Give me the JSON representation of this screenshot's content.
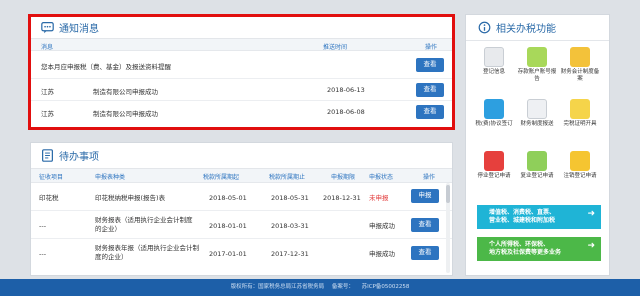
{
  "notice": {
    "title": "通知消息",
    "columns": [
      "消息",
      "推送时间",
      "操作"
    ],
    "rows": [
      {
        "source": "您本月应申报税（费、基金）及报送资料提醒",
        "desc": "",
        "date": "",
        "action": "查看"
      },
      {
        "source": "江苏",
        "desc": "制造有限公司申报成功",
        "date": "2018-06-13",
        "action": "查看"
      },
      {
        "source": "江苏",
        "desc": "制造有限公司申报成功",
        "date": "2018-06-08",
        "action": "查看"
      }
    ]
  },
  "todo": {
    "title": "待办事项",
    "columns": [
      "征收项目",
      "申报表种类",
      "税款所属期起",
      "税款所属期止",
      "申报期限",
      "申报状态",
      "操作"
    ],
    "rows": [
      {
        "item": "印花税",
        "form": "印花税纳税申报(报告)表",
        "start": "2018-05-01",
        "end": "2018-05-31",
        "deadline": "2018-12-31",
        "status": "未申报",
        "action": "申报"
      },
      {
        "item": "---",
        "form": "财务报表（适用执行企业会计制度的企业）",
        "start": "2018-01-01",
        "end": "2018-03-31",
        "deadline": "",
        "status": "申报成功",
        "action": "查看"
      },
      {
        "item": "---",
        "form": "财务报表年报（适用执行企业会计制度的企业）",
        "start": "2017-01-01",
        "end": "2017-12-31",
        "deadline": "",
        "status": "申报成功",
        "action": "查看"
      }
    ]
  },
  "related": {
    "title": "相关办税功能",
    "tiles": [
      {
        "label": "登记信息",
        "color": "#e8eaed",
        "icon": "id-card-icon"
      },
      {
        "label": "存款账户账号报告",
        "color": "#a8d85a",
        "icon": "bank-card-icon"
      },
      {
        "label": "财务会计制度备案",
        "color": "#f3c23a",
        "icon": "accounting-icon"
      },
      {
        "label": "税(费)协议签订",
        "color": "#2d9fe0",
        "icon": "agreement-icon"
      },
      {
        "label": "财务制度报送",
        "color": "#eef0f3",
        "icon": "report-icon"
      },
      {
        "label": "完税证明开具",
        "color": "#f5d44a",
        "icon": "certificate-icon"
      },
      {
        "label": "停业登记申请",
        "color": "#e6403d",
        "icon": "stop-business-icon"
      },
      {
        "label": "复业登记申请",
        "color": "#8fcf5a",
        "icon": "resume-business-icon"
      },
      {
        "label": "注销登记申请",
        "color": "#f5c531",
        "icon": "cancel-registration-icon"
      }
    ],
    "promos": [
      {
        "line1": "增值税、消费税、直票、",
        "line2": "营业税、城建税和附加税",
        "color": "#1fb4d6"
      },
      {
        "line1": "个人所得税、环保税、",
        "line2": "地方税及社保费等更多业务",
        "color": "#4cb848"
      }
    ]
  },
  "footer": {
    "copyright": "版权所有：国家税务总局江苏省税务局",
    "record_label": "备案号：",
    "record": "苏ICP备05002258"
  }
}
